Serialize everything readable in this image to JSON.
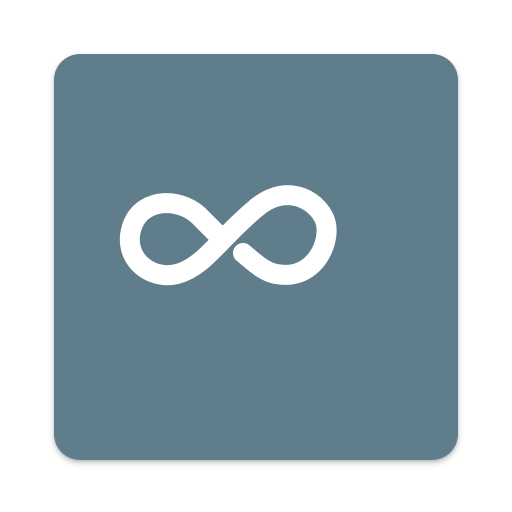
{
  "icon": {
    "name": "infinity-icon",
    "background_color": "#607d8b",
    "glyph_color": "#ffffff"
  }
}
